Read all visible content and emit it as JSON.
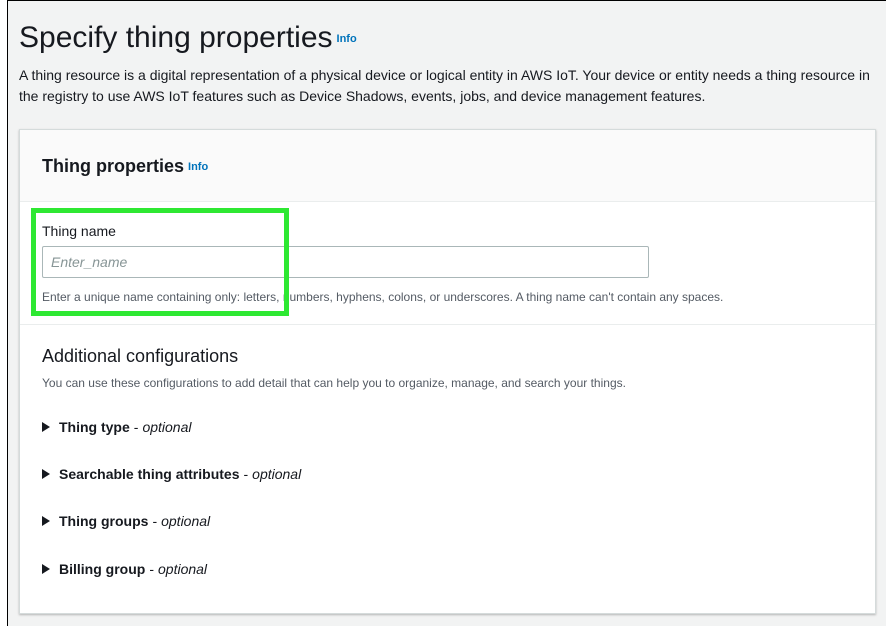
{
  "page": {
    "title": "Specify thing properties",
    "title_info": "Info",
    "description": "A thing resource is a digital representation of a physical device or logical entity in AWS IoT. Your device or entity needs a thing resource in the registry to use AWS IoT features such as Device Shadows, events, jobs, and device management features."
  },
  "thing_properties": {
    "title": "Thing properties",
    "title_info": "Info",
    "thing_name": {
      "label": "Thing name",
      "value": "",
      "placeholder": "Enter_name",
      "hint": "Enter a unique name containing only: letters, numbers, hyphens, colons, or underscores. A thing name can't contain any spaces."
    }
  },
  "additional": {
    "title": "Additional configurations",
    "description": "You can use these configurations to add detail that can help you to organize, manage, and search your things.",
    "dash": "-",
    "items": [
      {
        "label": "Thing type",
        "optional": "optional"
      },
      {
        "label": "Searchable thing attributes",
        "optional": "optional"
      },
      {
        "label": "Thing groups",
        "optional": "optional"
      },
      {
        "label": "Billing group",
        "optional": "optional"
      }
    ]
  },
  "colors": {
    "info_link": "#0073bb",
    "highlight": "#2ee832",
    "page_bg": "#f2f3f3"
  }
}
